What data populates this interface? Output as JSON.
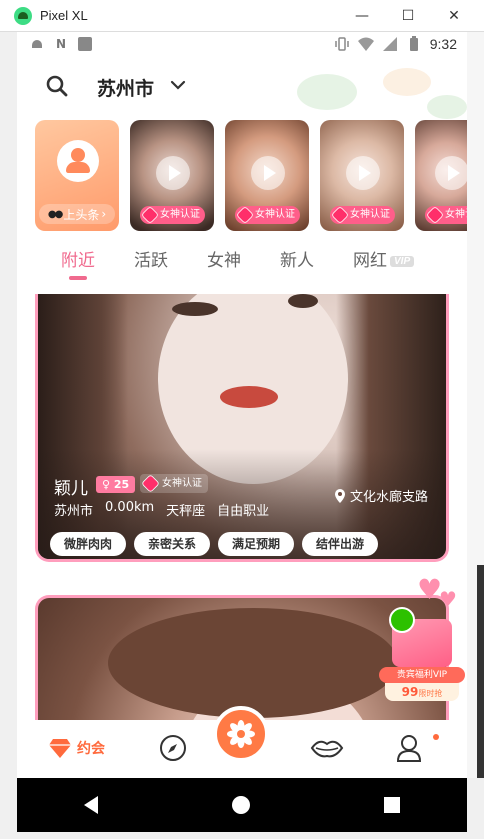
{
  "window": {
    "title": "Pixel XL",
    "minimize": "—",
    "maximize": "☐",
    "close": "✕"
  },
  "statusbar": {
    "time": "9:32"
  },
  "header": {
    "city": "苏州市"
  },
  "stories": {
    "me_button": "上头条",
    "badge": "女神认证"
  },
  "tabs": {
    "items": [
      "附近",
      "活跃",
      "女神",
      "新人",
      "网红"
    ],
    "vip": "VIP"
  },
  "card": {
    "name": "颖儿",
    "age": "25",
    "badge": "女神认证",
    "city": "苏州市",
    "distance": "0.00km",
    "zodiac": "天秤座",
    "job": "自由职业",
    "location": "文化水廊支路",
    "tags": [
      "微胖肉肉",
      "亲密关系",
      "满足预期",
      "结伴出游"
    ]
  },
  "promo": {
    "label": "贵宾福利VIP",
    "price": "99",
    "price_note": "限时抢"
  },
  "bottomnav": {
    "date_label": "约会"
  },
  "colors": {
    "accent": "#f06a8e",
    "orange": "#ff7a45"
  }
}
